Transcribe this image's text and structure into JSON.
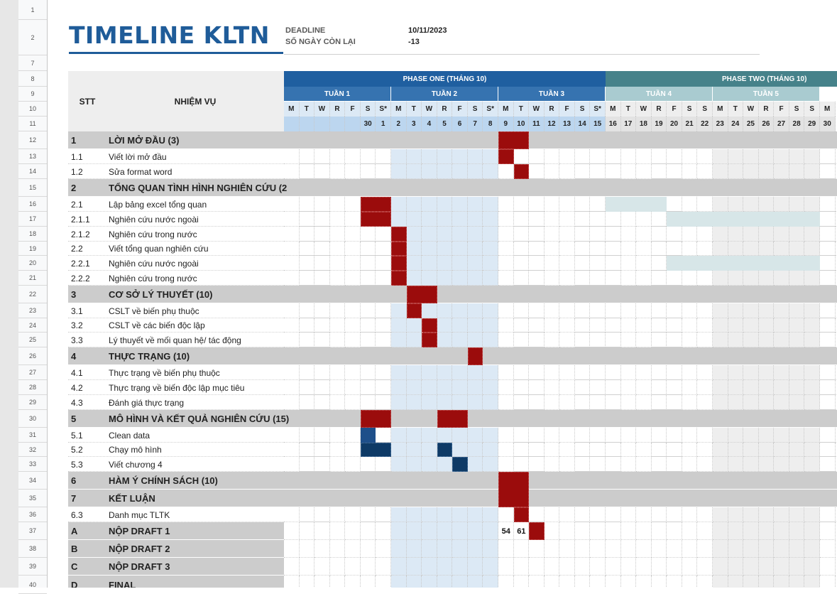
{
  "title": "TIMELINE KLTN",
  "deadline_label": "DEADLINE",
  "deadline_value": "10/11/2023",
  "days_left_label": "SỐ NGÀY CÒN LẠI",
  "days_left_value": "-13",
  "header": {
    "stt": "STT",
    "task": "NHIỆM VỤ",
    "phase_one": "PHASE ONE (THÁNG 10)",
    "phase_two": "PHASE TWO (THÁNG 10)"
  },
  "weeks": [
    "TUẦN 1",
    "TUẦN 2",
    "TUẦN 3",
    "TUẦN 4",
    "TUẦN 5"
  ],
  "day_letters": [
    "M",
    "T",
    "W",
    "R",
    "F",
    "S",
    "S*",
    "M",
    "T",
    "W",
    "R",
    "F",
    "S",
    "S*",
    "M",
    "T",
    "W",
    "R",
    "F",
    "S",
    "S*",
    "M",
    "T",
    "W",
    "R",
    "F",
    "S",
    "S",
    "M",
    "T",
    "W",
    "R",
    "F",
    "S",
    "S",
    "M"
  ],
  "day_numbers": [
    "",
    "",
    "",
    "",
    "",
    "30",
    "1",
    "2",
    "3",
    "4",
    "5",
    "6",
    "7",
    "8",
    "9",
    "10",
    "11",
    "12",
    "13",
    "14",
    "15",
    "16",
    "17",
    "18",
    "19",
    "20",
    "21",
    "22",
    "23",
    "24",
    "25",
    "26",
    "27",
    "28",
    "29",
    "30"
  ],
  "row_numbers": [
    "1",
    "2",
    "7",
    "8",
    "9",
    "10",
    "11",
    "12",
    "13",
    "14",
    "15",
    "16",
    "17",
    "18",
    "19",
    "20",
    "21",
    "22",
    "23",
    "24",
    "25",
    "26",
    "27",
    "28",
    "29",
    "30",
    "31",
    "32",
    "33",
    "34",
    "35",
    "36",
    "37",
    "38",
    "39",
    "40"
  ],
  "tasks": [
    {
      "id": "1",
      "name": "LỜI MỞ ĐẦU (3)",
      "section": true
    },
    {
      "id": "1.1",
      "name": "Viết lời mở đầu",
      "section": false
    },
    {
      "id": "1.2",
      "name": "Sửa format word",
      "section": false
    },
    {
      "id": "2",
      "name": "TỔNG QUAN TÌNH HÌNH NGHIÊN CỨU (2",
      "section": true
    },
    {
      "id": "2.1",
      "name": "Lập bảng excel tổng quan",
      "section": false
    },
    {
      "id": "2.1.1",
      "name": "Nghiên cứu nước ngoài",
      "section": false
    },
    {
      "id": "2.1.2",
      "name": "Nghiên cứu trong nước",
      "section": false
    },
    {
      "id": "2.2",
      "name": "Viết tổng quan nghiên cứu",
      "section": false
    },
    {
      "id": "2.2.1",
      "name": "Nghiên cứu nước ngoài",
      "section": false
    },
    {
      "id": "2.2.2",
      "name": "Nghiên cứu trong nước",
      "section": false
    },
    {
      "id": "3",
      "name": "CƠ SỞ LÝ THUYẾT (10)",
      "section": true
    },
    {
      "id": "3.1",
      "name": "CSLT về biến phụ thuộc",
      "section": false
    },
    {
      "id": "3.2",
      "name": "CSLT về các biến độc lập",
      "section": false
    },
    {
      "id": "3.3",
      "name": "Lý thuyết về mối quan hệ/ tác động",
      "section": false
    },
    {
      "id": "4",
      "name": "THỰC TRẠNG (10)",
      "section": true
    },
    {
      "id": "4.1",
      "name": "Thực trạng về biến phụ thuộc",
      "section": false
    },
    {
      "id": "4.2",
      "name": "Thực trạng về biến độc lập mục tiêu",
      "section": false
    },
    {
      "id": "4.3",
      "name": "Đánh giá thực trạng",
      "section": false
    },
    {
      "id": "5",
      "name": "MÔ HÌNH VÀ KẾT QUẢ NGHIÊN CỨU (15)",
      "section": true
    },
    {
      "id": "5.1",
      "name": "Clean data",
      "section": false
    },
    {
      "id": "5.2",
      "name": "Chạy mô hình",
      "section": false
    },
    {
      "id": "5.3",
      "name": "Viết chương 4",
      "section": false
    },
    {
      "id": "6",
      "name": "HÀM Ý CHÍNH SÁCH (10)",
      "section": true
    },
    {
      "id": "7",
      "name": "KẾT LUẬN",
      "section": true
    },
    {
      "id": "6.3",
      "name": "Danh mục TLTK",
      "section": false
    },
    {
      "id": "A",
      "name": "NỘP DRAFT 1",
      "section": true
    },
    {
      "id": "B",
      "name": "NỘP DRAFT 2",
      "section": true
    },
    {
      "id": "C",
      "name": "NỘP DRAFT 3",
      "section": true
    },
    {
      "id": "D",
      "name": "FINAL",
      "section": true
    }
  ],
  "draft_numbers": [
    "54",
    "61"
  ]
}
